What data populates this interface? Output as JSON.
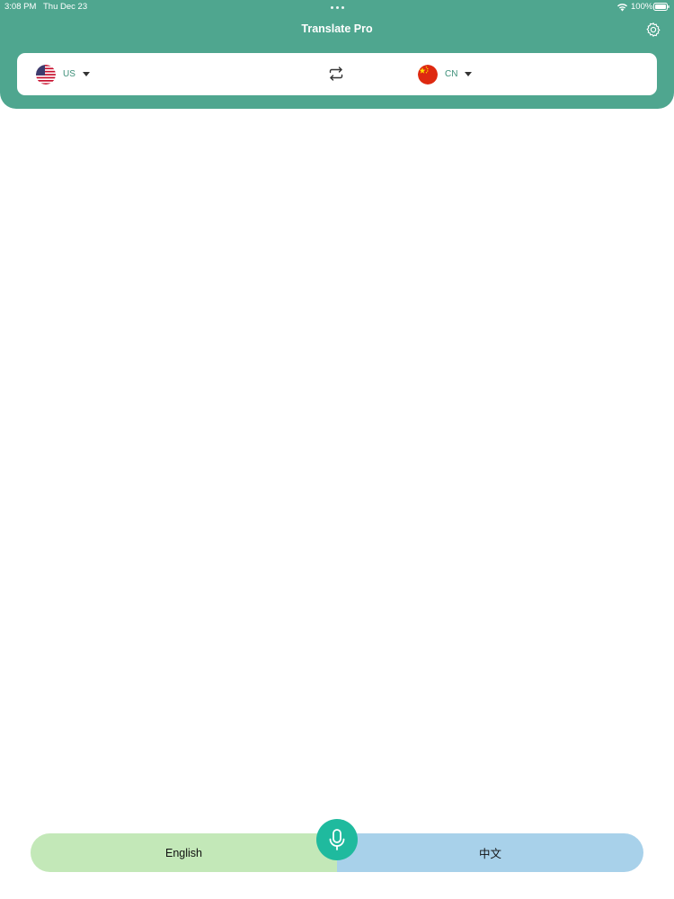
{
  "status_bar": {
    "time": "3:08 PM",
    "date": "Thu Dec 23",
    "battery": "100%",
    "wifi_icon": "wifi-icon",
    "battery_icon": "battery-icon"
  },
  "header": {
    "title": "Translate Pro",
    "settings_icon": "gear-icon",
    "background_color": "#4fa68f"
  },
  "language_selector": {
    "source": {
      "code": "US",
      "flag_icon": "us-flag-icon"
    },
    "swap_icon": "swap-arrows-icon",
    "target": {
      "code": "CN",
      "flag_icon": "china-flag-icon"
    }
  },
  "bottom": {
    "left_label": "English",
    "right_label": "中文",
    "mic_icon": "microphone-icon",
    "left_color": "#c3e8b8",
    "right_color": "#a8d1ea",
    "mic_color": "#1fba9e"
  }
}
